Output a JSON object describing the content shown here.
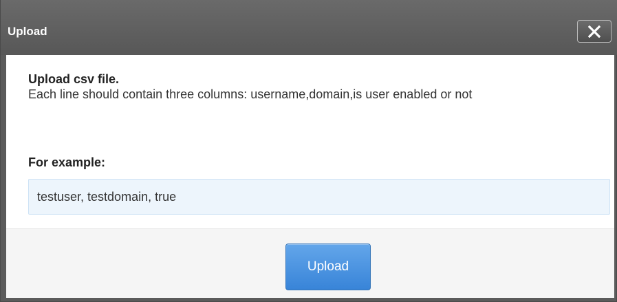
{
  "dialog": {
    "title": "Upload",
    "close_icon": "close-icon"
  },
  "content": {
    "heading": "Upload csv file.",
    "description": "Each line should contain three columns: username,domain,is user enabled or not",
    "example_label": "For example:",
    "example_value": "testuser, testdomain, true"
  },
  "footer": {
    "upload_label": "Upload"
  },
  "colors": {
    "titlebar": "#5b5b5b",
    "primary_button": "#4a90e2",
    "example_background": "#edf5fc"
  }
}
